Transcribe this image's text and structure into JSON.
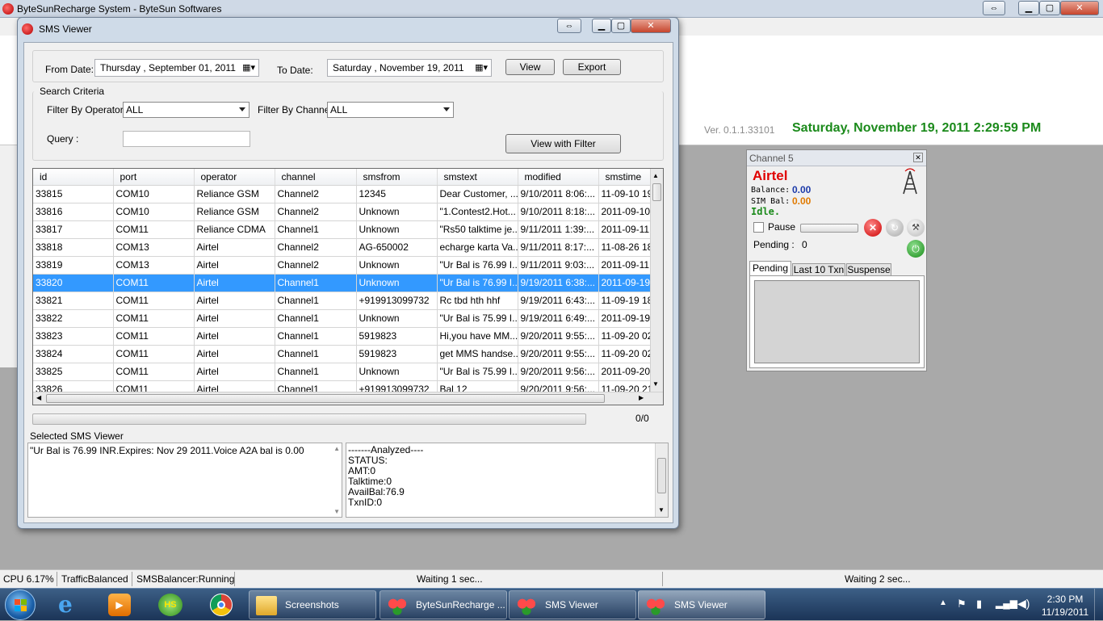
{
  "main_window": {
    "title": "ByteSunRecharge System - ByteSun Softwares",
    "version": "Ver. 0.1.1.33101",
    "clock": "Saturday, November 19, 2011 2:29:59 PM"
  },
  "channel_panel": {
    "title": "Channel 5",
    "operator": "Airtel",
    "balance_label": "Balance:",
    "balance_value": "0.00",
    "sim_bal_label": "SIM Bal:",
    "sim_bal_value": "0.00",
    "state": "Idle.",
    "pause_label": "Pause",
    "pending_label": "Pending :",
    "pending_value": "0",
    "tabs": [
      "Pending",
      "Last 10 Txn",
      "Suspense"
    ],
    "colors": {
      "operator": "#e00000",
      "balance": "#1c3aa9",
      "sim_bal": "#e07a00",
      "state": "#1b8a1b"
    }
  },
  "sms_viewer": {
    "title": "SMS Viewer",
    "from_date_label": "From Date:",
    "from_date": "Thursday  , September 01, 2011",
    "to_date_label": "To Date:",
    "to_date": "Saturday  , November 19, 2011",
    "view_button": "View",
    "export_button": "Export",
    "search_criteria_label": "Search Criteria",
    "filter_operator_label": "Filter By Operator:",
    "filter_operator_value": "ALL",
    "filter_channel_label": "Filter By Channel:",
    "filter_channel_value": "ALL",
    "query_label": "Query :",
    "query_value": "",
    "view_filter_button": "View with Filter",
    "columns": [
      "id",
      "port",
      "operator",
      "channel",
      "smsfrom",
      "smstext",
      "modified",
      "smstime"
    ],
    "rows": [
      [
        "33815",
        "COM10",
        "Reliance GSM",
        "Channel2",
        "12345",
        "Dear Customer, ...",
        "9/10/2011 8:06:...",
        "11-09-10 19:"
      ],
      [
        "33816",
        "COM10",
        "Reliance GSM",
        "Channel2",
        "Unknown",
        "\"1.Contest2.Hot...",
        "9/10/2011 8:18:...",
        "2011-09-10 2"
      ],
      [
        "33817",
        "COM11",
        "Reliance CDMA",
        "Channel1",
        "Unknown",
        "\"Rs50 talktime je...",
        "9/11/2011 1:39:...",
        "2011-09-11 1"
      ],
      [
        "33818",
        "COM13",
        "Airtel",
        "Channel2",
        "AG-650002",
        "echarge karta Va...",
        "9/11/2011 8:17:...",
        "11-08-26 18:"
      ],
      [
        "33819",
        "COM13",
        "Airtel",
        "Channel2",
        "Unknown",
        "\"Ur Bal is 76.99 I...",
        "9/11/2011 9:03:...",
        "2011-09-11 2"
      ],
      [
        "33820",
        "COM11",
        "Airtel",
        "Channel1",
        "Unknown",
        "\"Ur Bal is 76.99 I...",
        "9/19/2011 6:38:...",
        "2011-09-19"
      ],
      [
        "33821",
        "COM11",
        "Airtel",
        "Channel1",
        "+919913099732",
        "Rc tbd hth hhf",
        "9/19/2011 6:43:...",
        "11-09-19 18:"
      ],
      [
        "33822",
        "COM11",
        "Airtel",
        "Channel1",
        "Unknown",
        "\"Ur Bal is 75.99 I...",
        "9/19/2011 6:49:...",
        "2011-09-19"
      ],
      [
        "33823",
        "COM11",
        "Airtel",
        "Channel1",
        "5919823",
        "Hi,you have MM...",
        "9/20/2011 9:55:...",
        "11-09-20 02:"
      ],
      [
        "33824",
        "COM11",
        "Airtel",
        "Channel1",
        "5919823",
        "get MMS handse...",
        "9/20/2011 9:55:...",
        "11-09-20 02:"
      ],
      [
        "33825",
        "COM11",
        "Airtel",
        "Channel1",
        "Unknown",
        "\"Ur Bal is 75.99 I...",
        "9/20/2011 9:56:...",
        "2011-09-20 2"
      ],
      [
        "33826",
        "COM11",
        "Airtel",
        "Channel1",
        "+919913099732",
        "Bal 12",
        "9/20/2011 9:56:...",
        "11-09-20 21:"
      ]
    ],
    "selected_row_index": 5,
    "progress_text": "0/0",
    "selected_sms_label": "Selected SMS Viewer",
    "selected_sms_text": "\"Ur Bal is 76.99 INR.Expires: Nov 29 2011.Voice A2A bal is 0.00",
    "analyzed_lines": [
      "-------Analyzed----",
      "STATUS:",
      "AMT:0",
      "Talktime:0",
      "AvailBal:76.9",
      "TxnID:0"
    ]
  },
  "status_bar": {
    "cpu": "CPU 6.17%",
    "traffic": "TrafficBalanced",
    "balancer": "SMSBalancer:Running",
    "wait1": "Waiting 1 sec...",
    "wait2": "Waiting 2 sec..."
  },
  "taskbar": {
    "items": [
      "Screenshots",
      "ByteSunRecharge ...",
      "SMS Viewer",
      "SMS Viewer"
    ],
    "time": "2:30 PM",
    "date": "11/19/2011"
  },
  "icons": {
    "app": "bytesun-app-icon",
    "tower": "tower-icon",
    "stop": "stop-icon",
    "refresh": "refresh-icon",
    "tools": "tools-icon",
    "connect": "connect-icon"
  }
}
